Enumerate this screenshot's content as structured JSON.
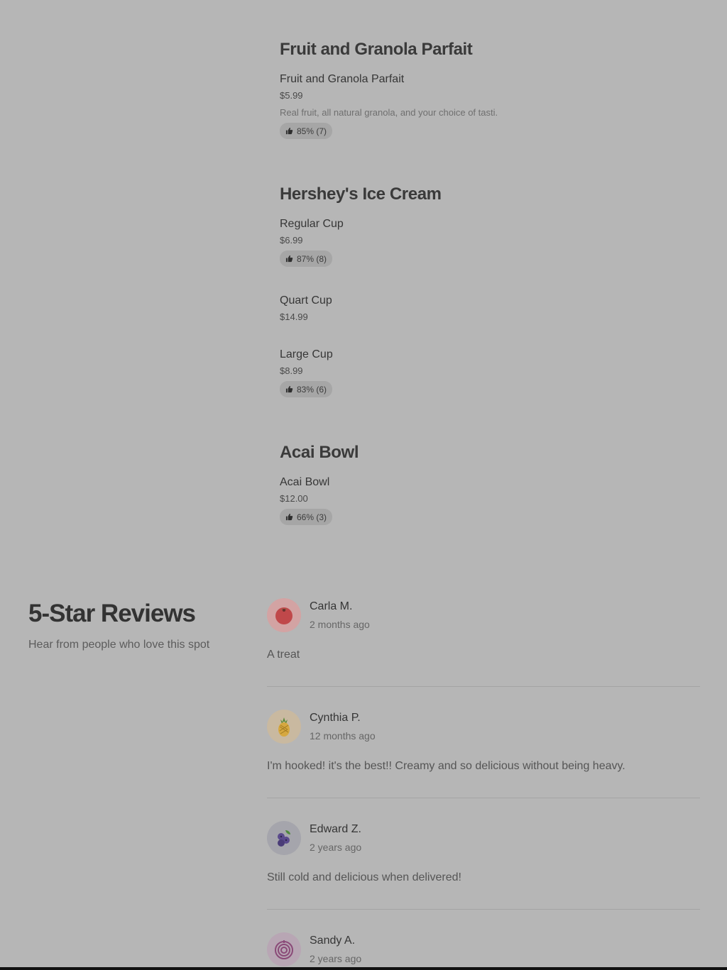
{
  "menu": {
    "sections": [
      {
        "title": "Fruit and Granola Parfait",
        "items": [
          {
            "name": "Fruit and Granola Parfait",
            "price": "$5.99",
            "description": "Real fruit, all natural granola, and your choice of tasti.",
            "rating": "85% (7)"
          }
        ]
      },
      {
        "title": "Hershey's Ice Cream",
        "items": [
          {
            "name": "Regular Cup",
            "price": "$6.99",
            "rating": "87% (8)"
          },
          {
            "name": "Quart Cup",
            "price": "$14.99"
          },
          {
            "name": "Large Cup",
            "price": "$8.99",
            "rating": "83% (6)"
          }
        ]
      },
      {
        "title": "Acai Bowl",
        "items": [
          {
            "name": "Acai Bowl",
            "price": "$12.00",
            "rating": "66% (3)"
          }
        ]
      }
    ]
  },
  "reviews": {
    "title": "5-Star Reviews",
    "subtitle": "Hear from people who love this spot",
    "items": [
      {
        "name": "Carla M.",
        "date": "2 months ago",
        "text": "A treat",
        "avatar_icon": "tomato-icon",
        "avatar_bg": "#d3a3a3"
      },
      {
        "name": "Cynthia P.",
        "date": "12 months ago",
        "text": "I'm hooked! it's the best!! Creamy and so delicious without being heavy.",
        "avatar_icon": "pineapple-icon",
        "avatar_bg": "#c9b9a0"
      },
      {
        "name": "Edward Z.",
        "date": "2 years ago",
        "text": "Still cold and delicious when delivered!",
        "avatar_icon": "blueberry-icon",
        "avatar_bg": "#a5a5ac"
      },
      {
        "name": "Sandy A.",
        "date": "2 years ago",
        "text": "",
        "avatar_icon": "onion-icon",
        "avatar_bg": "#b8a6b4"
      }
    ]
  }
}
